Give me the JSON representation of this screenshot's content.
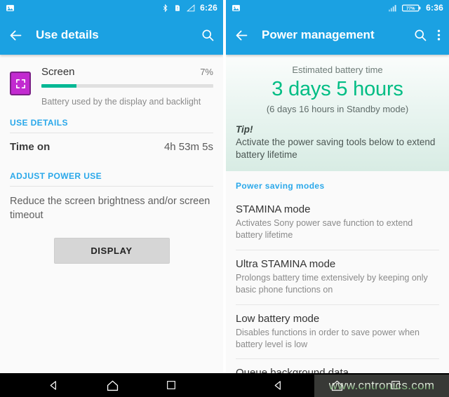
{
  "left_phone": {
    "status_bar": {
      "time": "6:26",
      "icons": [
        "image-icon",
        "bluetooth-icon",
        "sim-alert-icon",
        "signal-icon"
      ]
    },
    "app_bar": {
      "back_icon": "back-arrow-icon",
      "title": "Use details",
      "search_icon": "search-icon"
    },
    "screen_entry": {
      "icon": "screen-brightness-icon",
      "title": "Screen",
      "percent": "7%",
      "percent_value": 7,
      "description": "Battery used by the display and backlight"
    },
    "use_details_header": "USE DETAILS",
    "time_on": {
      "label": "Time on",
      "value": "4h 53m 5s"
    },
    "adjust_power_header": "ADJUST POWER USE",
    "advice": "Reduce the screen brightness and/or screen timeout",
    "display_button": "DISPLAY"
  },
  "right_phone": {
    "status_bar": {
      "time": "6:36",
      "battery": "77%",
      "icons": [
        "image-icon",
        "signal-bars-icon",
        "battery-icon"
      ]
    },
    "app_bar": {
      "back_icon": "back-arrow-icon",
      "title": "Power management",
      "search_icon": "search-icon",
      "overflow_icon": "overflow-menu-icon"
    },
    "battery_card": {
      "estimate_label": "Estimated battery time",
      "estimate_value": "3 days 5 hours",
      "standby_note": "(6 days 16 hours in Standby mode)",
      "tip_title": "Tip!",
      "tip_body": "Activate the power saving tools below to extend battery lifetime"
    },
    "power_saving_header": "Power saving modes",
    "modes": [
      {
        "title": "STAMINA mode",
        "description": "Activates Sony power save function to extend battery lifetime"
      },
      {
        "title": "Ultra STAMINA mode",
        "description": "Prolongs battery time extensively by keeping only basic phone functions on"
      },
      {
        "title": "Low battery mode",
        "description": "Disables functions in order to save power when battery level is low"
      },
      {
        "title": "Queue background data",
        "description": ""
      }
    ]
  },
  "nav_bar": {
    "back": "back-triangle-icon",
    "home": "home-icon",
    "recents": "recents-square-icon"
  },
  "watermark": "www.cntronics.com",
  "colors": {
    "accent_blue": "#1ba1e2",
    "link_blue": "#2aa8ea",
    "green": "#00bd84",
    "progress_green": "#00b894",
    "icon_purple": "#c22ad0"
  }
}
